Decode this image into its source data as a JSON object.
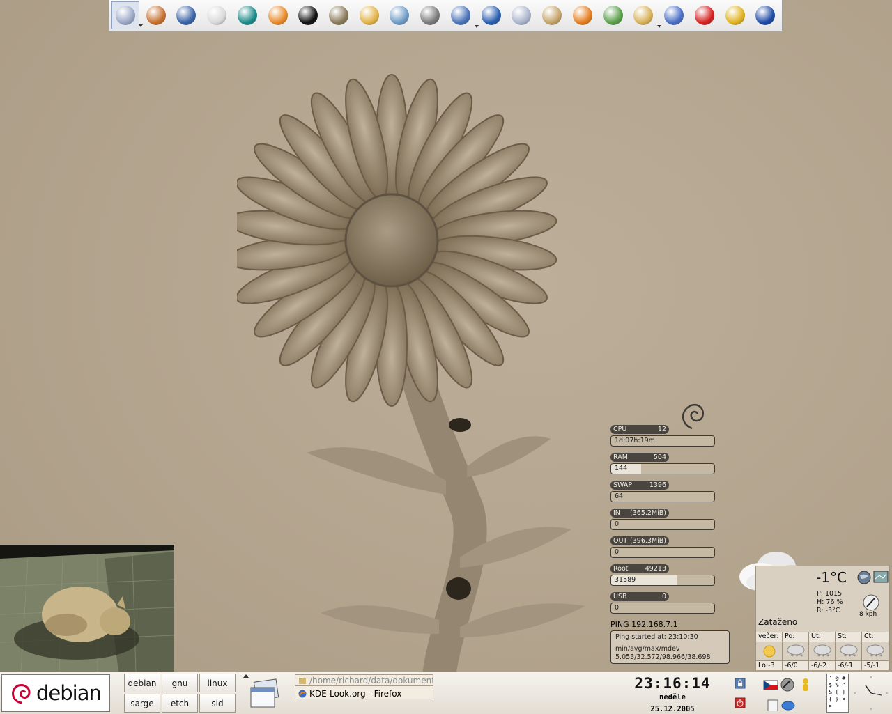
{
  "launcher": {
    "icons": [
      {
        "name": "kde-menu-icon",
        "color": "#9aa7c5"
      },
      {
        "name": "home-icon",
        "color": "#c7702f"
      },
      {
        "name": "konqueror-icon",
        "color": "#3b63a8"
      },
      {
        "name": "document-icon",
        "color": "#d9d9d9"
      },
      {
        "name": "eye-icon",
        "color": "#1d8b8b"
      },
      {
        "name": "blender-icon",
        "color": "#e98a2b"
      },
      {
        "name": "inkscape-icon",
        "color": "#111111"
      },
      {
        "name": "gimp-icon",
        "color": "#8b7a5a"
      },
      {
        "name": "palette-icon",
        "color": "#e2b347"
      },
      {
        "name": "image-viewer-icon",
        "color": "#6f9bc6"
      },
      {
        "name": "camera-icon",
        "color": "#7a7a7a"
      },
      {
        "name": "edit-icon",
        "color": "#4a74b8"
      },
      {
        "name": "chart-icon",
        "color": "#2a5fb0"
      },
      {
        "name": "calendar-icon",
        "color": "#aab5cc"
      },
      {
        "name": "package-icon",
        "color": "#c5a46a"
      },
      {
        "name": "media-player-icon",
        "color": "#e57f1f"
      },
      {
        "name": "balls-icon",
        "color": "#5aa04a"
      },
      {
        "name": "file-manager-icon",
        "color": "#d8b25a"
      },
      {
        "name": "network-icon",
        "color": "#4a6fc6"
      },
      {
        "name": "close-x-icon",
        "color": "#d62020"
      },
      {
        "name": "messenger-icon",
        "color": "#e0b320"
      },
      {
        "name": "globe-icon",
        "color": "#1c4aa6"
      }
    ]
  },
  "monitors": [
    {
      "name": "cpu",
      "label": "CPU",
      "max": "12",
      "value": "1d:07h:19m",
      "fill": 0
    },
    {
      "name": "ram",
      "label": "RAM",
      "max": "504",
      "value": "144",
      "fill": 0.29
    },
    {
      "name": "swap",
      "label": "SWAP",
      "max": "1396",
      "value": "64",
      "fill": 0
    },
    {
      "name": "in",
      "label": "IN",
      "max": "(365.2MiB)",
      "value": "0",
      "fill": 0
    },
    {
      "name": "out",
      "label": "OUT",
      "max": "(396.3MiB)",
      "value": "0",
      "fill": 0
    },
    {
      "name": "root",
      "label": "Root",
      "max": "49213",
      "value": "31589",
      "fill": 0.64
    },
    {
      "name": "usb",
      "label": "USB",
      "max": "0",
      "value": "0",
      "fill": 0
    }
  ],
  "ping": {
    "label": "PING",
    "host": "192.168.7.1",
    "line1": "Ping started at: 23:10:30",
    "line2": "min/avg/max/mdev",
    "line3": "5.053/32.572/98.966/38.698"
  },
  "weather": {
    "temp": "-1°C",
    "pressure": "P:  1015",
    "humidity": "H:  76 %",
    "real": "R:  -3°C",
    "wind": "8 kph",
    "condition": "Zataženo",
    "forecast": [
      {
        "day": "večer:",
        "temp": "Lo:-3",
        "icon": "sun-icon"
      },
      {
        "day": "Po:",
        "temp": "-6/0",
        "icon": "snow-cloud-icon"
      },
      {
        "day": "Út:",
        "temp": "-6/-2",
        "icon": "snow-cloud-icon"
      },
      {
        "day": "St:",
        "temp": "-6/-1",
        "icon": "snow-cloud-icon"
      },
      {
        "day": "Čt:",
        "temp": "-5/-1",
        "icon": "snow-cloud-icon"
      }
    ]
  },
  "panel": {
    "kmenu_label": "debian",
    "desktops": [
      "debian",
      "gnu",
      "linux",
      "sarge",
      "etch",
      "sid"
    ],
    "tasks": [
      {
        "label": "/home/richard/data/dokumenty",
        "active": false
      },
      {
        "label": "KDE-Look.org - Firefox",
        "active": true
      }
    ],
    "clock": {
      "time": "23:16:14",
      "day": "neděle",
      "date": "25.12.2005"
    },
    "charselect": "' @ #\n$ % ^\n& [ ]\n{ } <\n>"
  }
}
